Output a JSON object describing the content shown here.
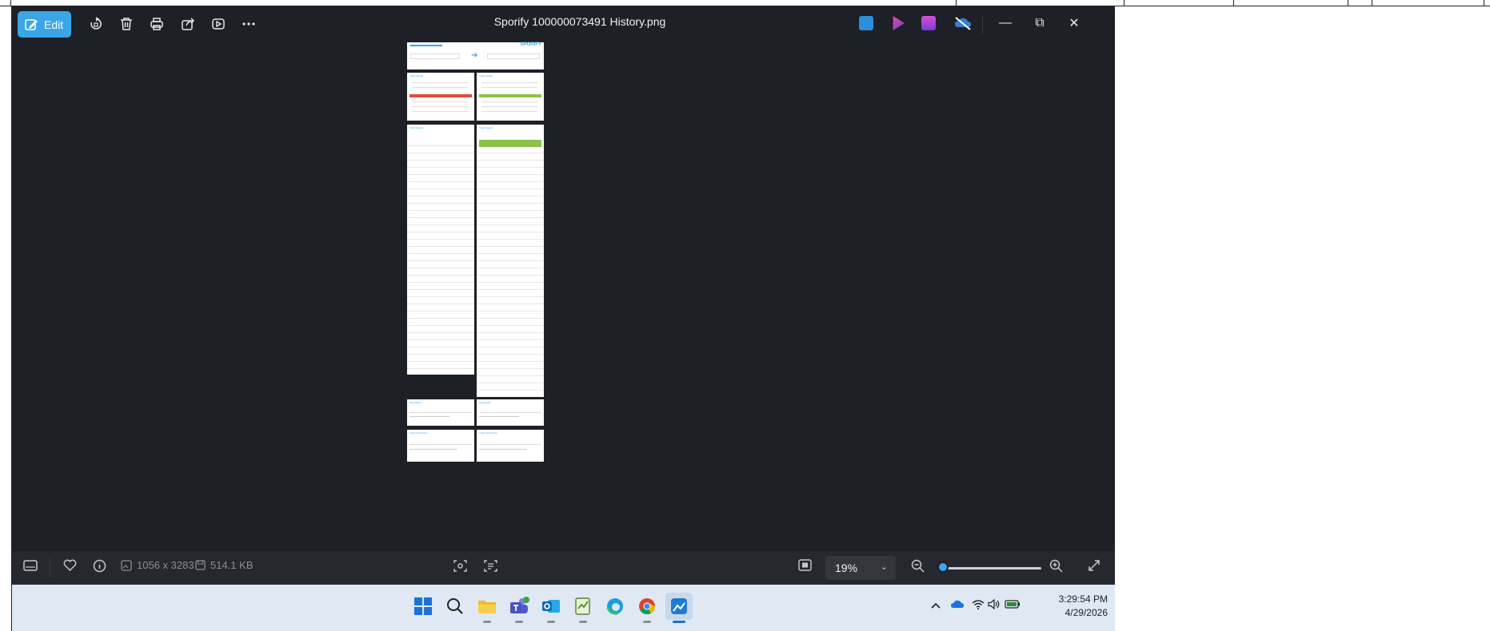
{
  "window": {
    "title": "Sporify 100000073491 History.png",
    "edit_label": "Edit"
  },
  "toolbar_icons": [
    "edit-icon",
    "rotate-icon",
    "delete-icon",
    "print-icon",
    "share-icon",
    "slideshow-icon",
    "more-icon"
  ],
  "app_icons": [
    "photos-app-icon",
    "clipchamp-icon",
    "clipchamp-purple-icon",
    "onedrive-offline-icon"
  ],
  "window_controls": {
    "minimize": "—",
    "restore": "⧉",
    "close": "✕"
  },
  "status_bar": {
    "dimensions": "1056 x 3283",
    "file_size": "514.1 KB",
    "zoom": "19%"
  },
  "taskbar": {
    "apps": [
      "start-icon",
      "search-icon",
      "file-explorer-icon",
      "teams-icon",
      "outlook-icon",
      "notepad-icon",
      "edge-icon",
      "chrome-icon",
      "photos-icon"
    ],
    "time": "3:29:54 PM",
    "date": "4/29/2026"
  },
  "preview_doc": {
    "brand": "SPORIFY",
    "panels_top": [
      "Track details",
      "Track details"
    ],
    "panels_mid": [
      "Track Assets",
      "Track Assets"
    ],
    "panels_low": [
      "Description",
      "Description"
    ],
    "panels_bottom": [
      "Track Ownership",
      "Track Ownership"
    ]
  },
  "colors": {
    "accent": "#3aa6e6",
    "highlight_red": "#e34b3c",
    "highlight_green": "#8ac24a",
    "app_bg": "#1d2026",
    "taskbar_bg": "#dfe8f3"
  }
}
